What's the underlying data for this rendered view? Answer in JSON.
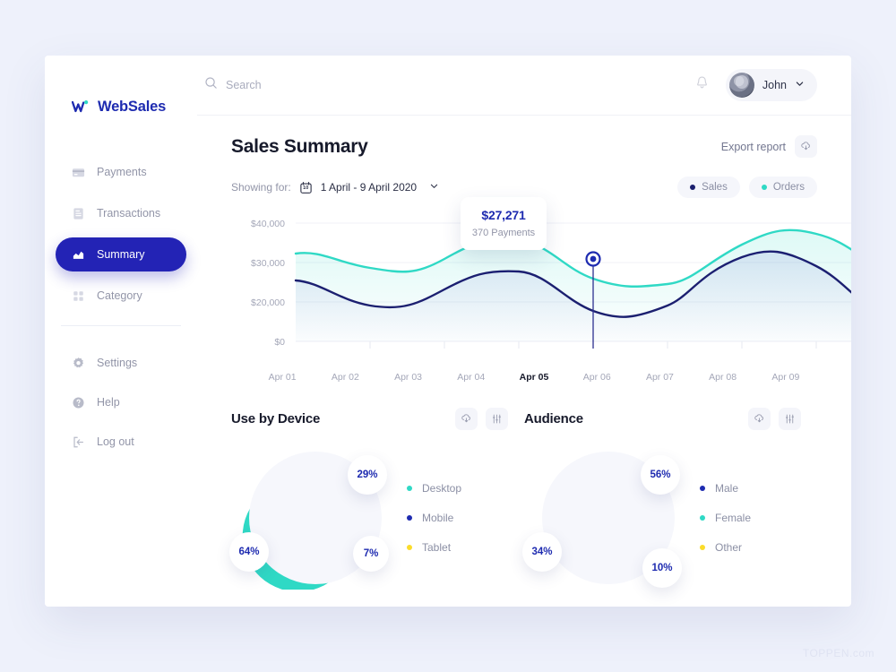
{
  "brand": {
    "name": "WebSales"
  },
  "colors": {
    "navy": "#1e2bb0",
    "navy_dark": "#1b1f6e",
    "primary": "#2323b5",
    "teal": "#2fd9c5",
    "yellow": "#fbdc2a",
    "muted": "#9295a8",
    "page_bg": "#eef1fb"
  },
  "sidebar": {
    "items": [
      {
        "label": "Payments",
        "icon": "card-icon",
        "active": false
      },
      {
        "label": "Transactions",
        "icon": "receipt-icon",
        "active": false
      },
      {
        "label": "Summary",
        "icon": "chart-bar-icon",
        "active": true
      },
      {
        "label": "Category",
        "icon": "grid-icon",
        "active": false
      }
    ],
    "bottom_items": [
      {
        "label": "Settings",
        "icon": "gear-icon"
      },
      {
        "label": "Help",
        "icon": "question-circle-icon"
      },
      {
        "label": "Log out",
        "icon": "logout-icon"
      }
    ]
  },
  "topbar": {
    "search_placeholder": "Search",
    "search_value": "",
    "bell_icon": "bell-icon",
    "user_name": "John",
    "chevron_icon": "chevron-down-icon"
  },
  "header": {
    "title": "Sales Summary",
    "export_label": "Export report",
    "export_icon": "download-cloud-icon"
  },
  "filter": {
    "showing_label": "Showing for:",
    "calendar_day": "10",
    "date_range": "1 April - 9 April 2020",
    "legend": [
      {
        "label": "Sales",
        "color": "#1b1f6e"
      },
      {
        "label": "Orders",
        "color": "#2fd9c5"
      }
    ]
  },
  "tooltip": {
    "value": "$27,271",
    "sub": "370 Payments"
  },
  "chart_data": {
    "type": "line",
    "title": "Sales Summary",
    "xlabel": "",
    "ylabel": "",
    "ylim": [
      0,
      45000
    ],
    "yticks": [
      0,
      20000,
      30000,
      40000
    ],
    "ytick_labels": [
      "$0",
      "$20,000",
      "$30,000",
      "$40,000"
    ],
    "categories": [
      "Apr 01",
      "Apr 02",
      "Apr 03",
      "Apr 04",
      "Apr 05",
      "Apr 06",
      "Apr 07",
      "Apr 08",
      "Apr 09"
    ],
    "highlight_category": "Apr 05",
    "grid": true,
    "legend_position": "top-right",
    "series": [
      {
        "name": "Orders",
        "color": "#2fd9c5",
        "values": [
          31500,
          28500,
          27500,
          32500,
          28500,
          25500,
          27500,
          32000,
          27500
        ]
      },
      {
        "name": "Sales",
        "color": "#1b1f6e",
        "values": [
          25000,
          21500,
          20500,
          25000,
          21000,
          18500,
          20500,
          28000,
          27271,
          24000
        ]
      }
    ],
    "marker": {
      "category": "Apr 05",
      "value": 27271,
      "label": "$27,271",
      "sublabel": "370 Payments"
    }
  },
  "device_panel": {
    "title": "Use by Device",
    "actions": [
      {
        "icon": "download-cloud-icon"
      },
      {
        "icon": "sliders-icon"
      }
    ],
    "chart": {
      "type": "pie",
      "title": "Use by Device",
      "labels": [
        "Desktop",
        "Mobile",
        "Tablet"
      ],
      "values": [
        64,
        29,
        7
      ],
      "value_labels": [
        "64%",
        "29%",
        "7%"
      ],
      "colors": [
        "#2fd9c5",
        "#1e2bb0",
        "#fbdc2a"
      ]
    }
  },
  "audience_panel": {
    "title": "Audience",
    "actions": [
      {
        "icon": "download-cloud-icon"
      },
      {
        "icon": "sliders-icon"
      }
    ],
    "chart": {
      "type": "pie",
      "title": "Audience",
      "labels": [
        "Male",
        "Female",
        "Other"
      ],
      "values": [
        56,
        34,
        10
      ],
      "value_labels": [
        "56%",
        "34%",
        "10%"
      ],
      "colors": [
        "#1e2bb0",
        "#2fd9c5",
        "#fbdc2a"
      ]
    }
  },
  "watermark": "TOPPEN.com"
}
